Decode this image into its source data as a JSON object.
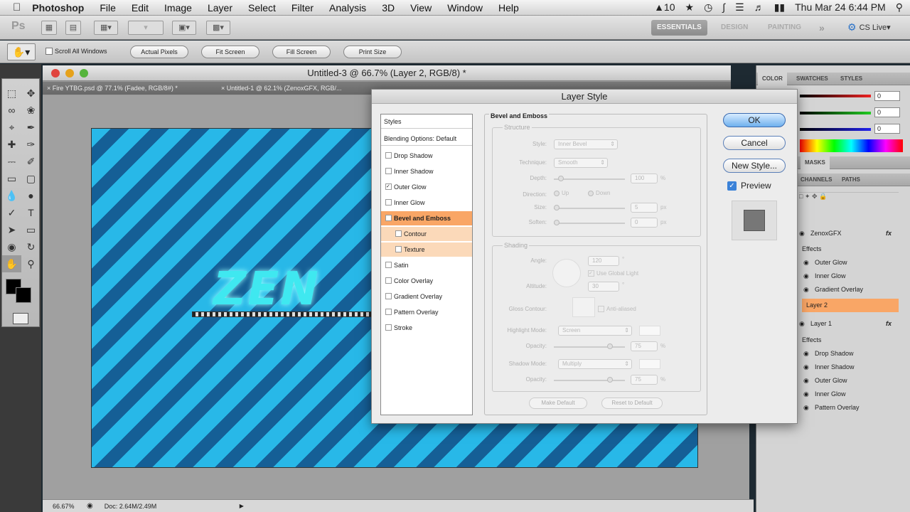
{
  "menubar": {
    "app": "Photoshop",
    "items": [
      "File",
      "Edit",
      "Image",
      "Layer",
      "Select",
      "Filter",
      "Analysis",
      "3D",
      "View",
      "Window",
      "Help"
    ],
    "status_number": "10",
    "datetime": "Thu Mar 24  6:44 PM"
  },
  "appbar": {
    "logo": "Ps",
    "workspaces": [
      "ESSENTIALS",
      "DESIGN",
      "PAINTING"
    ],
    "cslive": "CS Live"
  },
  "options": {
    "scroll_all": "Scroll All Windows",
    "buttons": [
      "Actual Pixels",
      "Fit Screen",
      "Fill Screen",
      "Print Size"
    ]
  },
  "document": {
    "title": "Untitled-3 @ 66.7% (Layer 2, RGB/8) *",
    "tabs": [
      "Fire YTBG.psd @ 77.1% (Fadee, RGB/8#) *",
      "Untitled-1 @ 62.1% (ZenoxGFX, RGB/..."
    ],
    "zoom": "66.67%",
    "doc_info": "Doc: 2.64M/2.49M"
  },
  "canvas": {
    "logo_text": "ZEN"
  },
  "panels": {
    "color_tabs": [
      "COLOR",
      "SWATCHES",
      "STYLES"
    ],
    "color_values": [
      "0",
      "0",
      "0"
    ],
    "adjust_tabs": [
      "MASKS"
    ],
    "layer_tabs": [
      "CHANNELS",
      "PATHS"
    ],
    "layers": [
      {
        "name": "ZenoxGFX",
        "type": "layer",
        "fx": "fx"
      },
      {
        "name": "Effects",
        "type": "effects"
      },
      {
        "name": "Outer Glow",
        "type": "effect"
      },
      {
        "name": "Inner Glow",
        "type": "effect"
      },
      {
        "name": "Gradient Overlay",
        "type": "effect"
      },
      {
        "name": "Layer 2",
        "type": "selected"
      },
      {
        "name": "Layer 1",
        "type": "layer",
        "fx": "fx"
      },
      {
        "name": "Effects",
        "type": "effects"
      },
      {
        "name": "Drop Shadow",
        "type": "effect"
      },
      {
        "name": "Inner Shadow",
        "type": "effect"
      },
      {
        "name": "Outer Glow",
        "type": "effect"
      },
      {
        "name": "Inner Glow",
        "type": "effect"
      },
      {
        "name": "Pattern Overlay",
        "type": "effect"
      }
    ]
  },
  "dialog": {
    "title": "Layer Style",
    "styles_header": "Styles",
    "blending": "Blending Options: Default",
    "style_items": [
      {
        "label": "Drop Shadow",
        "checked": false,
        "sub": false
      },
      {
        "label": "Inner Shadow",
        "checked": false,
        "sub": false
      },
      {
        "label": "Outer Glow",
        "checked": true,
        "sub": false
      },
      {
        "label": "Inner Glow",
        "checked": false,
        "sub": false
      },
      {
        "label": "Bevel and Emboss",
        "checked": false,
        "sub": false,
        "selected": true
      },
      {
        "label": "Contour",
        "checked": false,
        "sub": true
      },
      {
        "label": "Texture",
        "checked": false,
        "sub": true
      },
      {
        "label": "Satin",
        "checked": false,
        "sub": false
      },
      {
        "label": "Color Overlay",
        "checked": false,
        "sub": false
      },
      {
        "label": "Gradient Overlay",
        "checked": false,
        "sub": false
      },
      {
        "label": "Pattern Overlay",
        "checked": false,
        "sub": false
      },
      {
        "label": "Stroke",
        "checked": false,
        "sub": false
      }
    ],
    "section_title": "Bevel and Emboss",
    "structure": {
      "label": "Structure",
      "style_label": "Style:",
      "style_value": "Inner Bevel",
      "technique_label": "Technique:",
      "technique_value": "Smooth",
      "depth_label": "Depth:",
      "depth_value": "100",
      "depth_unit": "%",
      "direction_label": "Direction:",
      "up": "Up",
      "down": "Down",
      "size_label": "Size:",
      "size_value": "5",
      "size_unit": "px",
      "soften_label": "Soften:",
      "soften_value": "0",
      "soften_unit": "px"
    },
    "shading": {
      "label": "Shading",
      "angle_label": "Angle:",
      "angle_value": "120",
      "angle_unit": "°",
      "global_light": "Use Global Light",
      "altitude_label": "Altitude:",
      "altitude_value": "30",
      "altitude_unit": "°",
      "gloss_label": "Gloss Contour:",
      "anti_aliased": "Anti-aliased",
      "highlight_label": "Highlight Mode:",
      "highlight_value": "Screen",
      "h_opacity_label": "Opacity:",
      "h_opacity_value": "75",
      "h_opacity_unit": "%",
      "shadow_label": "Shadow Mode:",
      "shadow_value": "Multiply",
      "s_opacity_label": "Opacity:",
      "s_opacity_value": "75",
      "s_opacity_unit": "%"
    },
    "make_default": "Make Default",
    "reset_default": "Reset to Default",
    "ok": "OK",
    "cancel": "Cancel",
    "new_style": "New Style...",
    "preview": "Preview"
  }
}
